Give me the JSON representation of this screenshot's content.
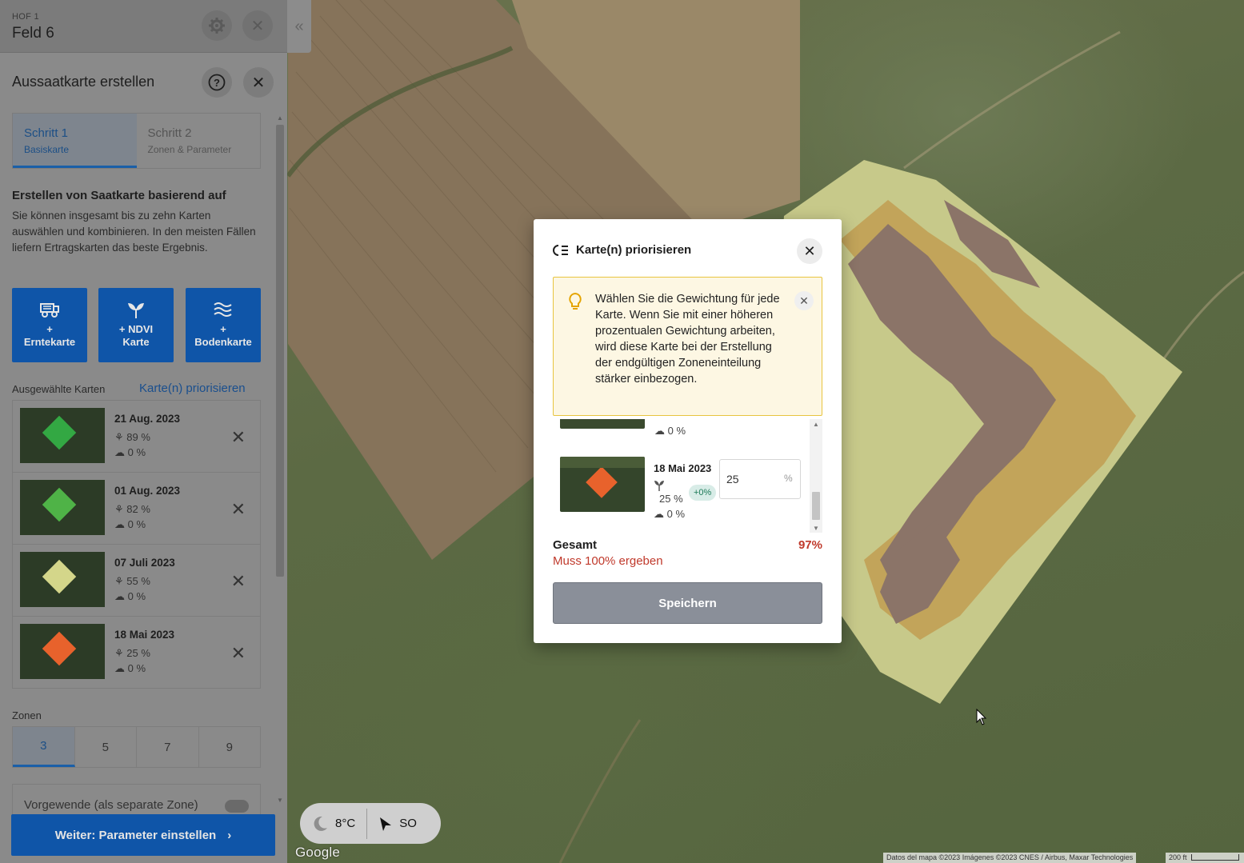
{
  "field": {
    "farm_label": "HOF 1",
    "title": "Feld 6"
  },
  "panel": {
    "title": "Aussaatkarte erstellen",
    "steps": [
      {
        "name": "Schritt 1",
        "sub": "Basiskarte",
        "active": true
      },
      {
        "name": "Schritt 2",
        "sub": "Zonen & Parameter",
        "active": false
      }
    ],
    "section_heading": "Erstellen von Saatkarte basierend auf",
    "section_desc": "Sie können insgesamt bis zu zehn Karten auswählen und kombinieren. In den meisten Fällen liefern Ertragskarten das beste Ergebnis.",
    "add_buttons": [
      {
        "line1": "+",
        "line2": "Erntekarte",
        "icon": "harvester-icon"
      },
      {
        "line1": "+ NDVI",
        "line2": "Karte",
        "icon": "sprout-icon"
      },
      {
        "line1": "+",
        "line2": "Bodenkarte",
        "icon": "soil-waves-icon"
      }
    ],
    "selected_label": "Ausgewählte Karten",
    "prioritize_link": "Karte(n) priorisieren",
    "cards": [
      {
        "date": "21 Aug. 2023",
        "ndvi": "89 %",
        "cloud": "0 %",
        "color": "#33a843"
      },
      {
        "date": "01 Aug. 2023",
        "ndvi": "82 %",
        "cloud": "0 %",
        "color": "#4fb347"
      },
      {
        "date": "07 Juli 2023",
        "ndvi": "55 %",
        "cloud": "0 %",
        "color": "#d4d68a"
      },
      {
        "date": "18 Mai 2023",
        "ndvi": "25 %",
        "cloud": "0 %",
        "color": "#e8622c"
      }
    ],
    "zones_label": "Zonen",
    "zones": [
      "3",
      "5",
      "7",
      "9"
    ],
    "zones_selected": "3",
    "headland_label": "Vorgewende (als separate Zone)",
    "next_button": "Weiter: Parameter einstellen",
    "next_chevron": "›"
  },
  "map": {
    "temperature": "8°C",
    "wind": "SO",
    "google": "Google",
    "attribution": "Datos del mapa ©2023 Imágenes ©2023 CNES / Airbus, Maxar Technologies",
    "scale": "200 ft",
    "zone_colors": [
      "#8b7468",
      "#c2a45a",
      "#c7c98a"
    ]
  },
  "modal": {
    "title": "Karte(n) priorisieren",
    "info_text": "Wählen Sie die Gewichtung für jede Karte. Wenn Sie mit einer höheren prozentualen Gewichtung arbeiten, wird diese Karte bei der Erstellung der endgültigen Zoneneinteilung stärker einbezogen.",
    "partial_cloud": "0 %",
    "item": {
      "date": "18 Mai 2023",
      "ndvi": "25 %",
      "badge": "+0%",
      "cloud": "0 %",
      "weight": "25",
      "unit": "%"
    },
    "total_label": "Gesamt",
    "total_value": "97%",
    "total_hint": "Muss 100% ergeben",
    "save_button": "Speichern"
  }
}
